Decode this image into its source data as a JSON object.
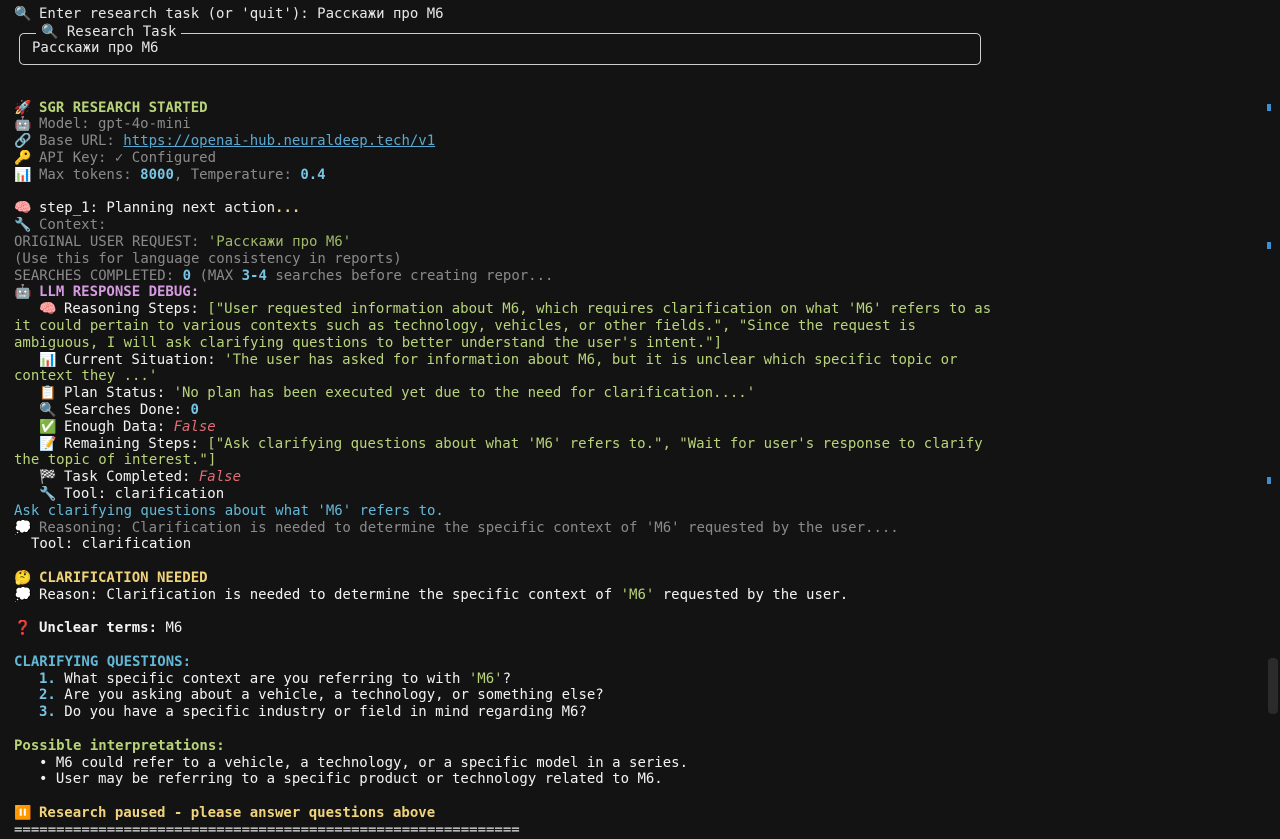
{
  "prompt": {
    "icon": "🔍",
    "text": "Enter research task (or 'quit'): Расскажи про M6"
  },
  "task_panel": {
    "title": "🔍 Research Task",
    "body": "Расскажи про M6"
  },
  "started": {
    "icon": "🚀",
    "title": "SGR RESEARCH STARTED",
    "model_icon": "🤖",
    "model": "Model: gpt-4o-mini",
    "url_icon": "🔗",
    "url_label": "Base URL: ",
    "url": "https://openai-hub.neuraldeep.tech/v1",
    "key_icon": "🔑",
    "key": "API Key: ✓ Configured",
    "tokens_icon": "📊",
    "tokens_label": "Max tokens: ",
    "tokens_value": "8000",
    "temp_label": ", Temperature: ",
    "temp_value": "0.4"
  },
  "step": {
    "icon": "🧠",
    "title": "step_1: Planning next action",
    "ellipsis": "...",
    "context_icon": "🔧",
    "context": "Context:",
    "orig_label": "ORIGINAL USER REQUEST: ",
    "orig_value": "'Расскажи про M6'",
    "consistency": "(Use this for language consistency in reports)",
    "searches_label": "SEARCHES COMPLETED: ",
    "searches_value": "0",
    "searches_mid": " (MAX ",
    "searches_range": "3-4",
    "searches_tail": " searches before creating repor..."
  },
  "debug": {
    "icon": "🤖",
    "title": "LLM RESPONSE DEBUG:",
    "reasoning_icon": "🧠",
    "reasoning_label": "Reasoning Steps: ",
    "reasoning_line1": "[\"User requested information about M6, which requires clarification on what 'M6' refers to as",
    "reasoning_line2": "it could pertain to various contexts such as technology, vehicles, or other fields.\", \"Since the request is",
    "reasoning_line3": "ambiguous, I will ask clarifying questions to better understand the user's intent.\"]",
    "situation_icon": "📊",
    "situation_label": "Current Situation: ",
    "situation_line1": "'The user has asked for information about M6, but it is unclear which specific topic or",
    "situation_line2": "context they ...'",
    "plan_icon": "📋",
    "plan_label": "Plan Status: ",
    "plan_value": "'No plan has been executed yet due to the need for clarification....'",
    "searches_icon": "🔍",
    "searches_label": "Searches Done: ",
    "searches_value": "0",
    "enough_icon": "✅",
    "enough_label": "Enough Data: ",
    "enough_value": "False",
    "remaining_icon": "📝",
    "remaining_label": "Remaining Steps: ",
    "remaining_line1": "[\"Ask clarifying questions about what 'M6' refers to.\", \"Wait for user's response to clarify",
    "remaining_line2": "the topic of interest.\"]",
    "completed_icon": "🏁",
    "completed_label": "Task Completed: ",
    "completed_value": "False",
    "tool_icon": "🔧",
    "tool": "Tool: clarification",
    "ask": "Ask clarifying questions about what 'M6' refers to.",
    "reasoning2_icon": "💭",
    "reasoning2": "Reasoning: Clarification is needed to determine the specific context of 'M6' requested by the user....",
    "tool2": "Tool: clarification"
  },
  "clarification": {
    "icon": "🤔",
    "title": "CLARIFICATION NEEDED",
    "reason_icon": "💭",
    "reason_prefix": "Reason: Clarification is needed to determine the specific context of ",
    "reason_term": "'M6'",
    "reason_suffix": " requested by the user.",
    "unclear_icon": "❓",
    "unclear_label": "Unclear terms: ",
    "unclear_value": "M6",
    "questions_title": "CLARIFYING QUESTIONS:",
    "q1_num": "1.",
    "q1_prefix": " What specific context are you referring to with ",
    "q1_term": "'M6'",
    "q1_suffix": "?",
    "q2_num": "2.",
    "q2": " Are you asking about a vehicle, a technology, or something else?",
    "q3_num": "3.",
    "q3": " Do you have a specific industry or field in mind regarding M6?",
    "interp_title": "Possible interpretations:",
    "interp1": "• M6 could refer to a vehicle, a technology, or a specific model in a series.",
    "interp2": "• User may be referring to a specific product or technology related to M6.",
    "paused_icon": "⏸️",
    "paused": "Research paused - please answer questions above",
    "rule": "============================================================"
  }
}
